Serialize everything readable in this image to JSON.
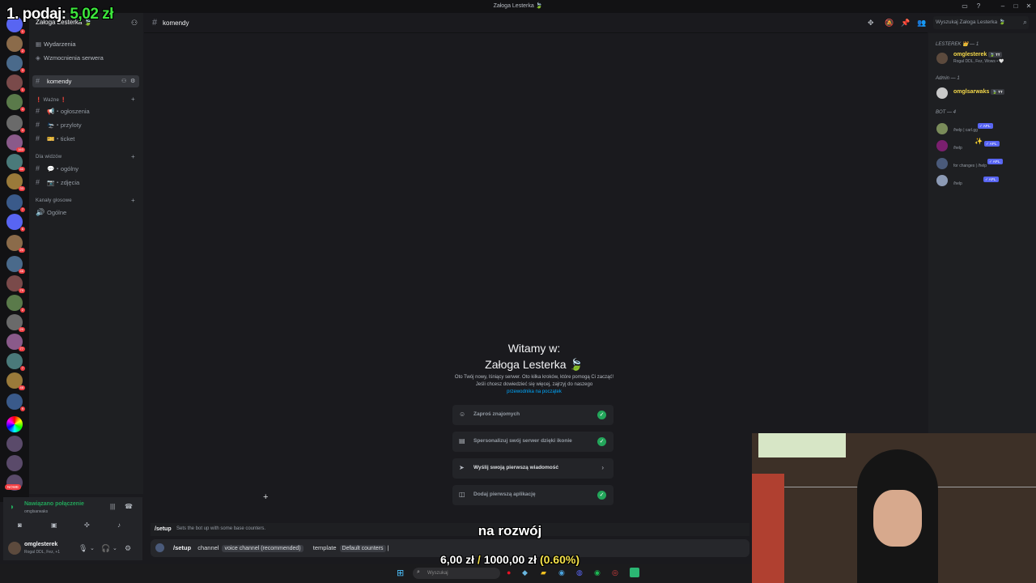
{
  "window": {
    "title": "Załoga Lesterka 🍃"
  },
  "server": {
    "name": "Załoga Lesterka 🍃",
    "nav": [
      {
        "label": "Wydarzenia",
        "icon": "calendar-icon"
      },
      {
        "label": "Wzmocnienia serwera",
        "icon": "boost-icon"
      }
    ],
    "active_channel": "komendy",
    "categories": [
      {
        "name": "❗ Ważne ❗",
        "channels": [
          "📢・ogłoszenia",
          "🛬・przyloty",
          "🎫・ticket"
        ]
      },
      {
        "name": "Dla widzów",
        "channels": [
          "💬・ogólny",
          "📷・zdjęcia"
        ]
      },
      {
        "name": "Kanały głosowe",
        "channels": [
          "Ogólne"
        ]
      }
    ],
    "new_badge": "NOWE"
  },
  "rail_badges": [
    "1",
    "2",
    "3",
    "1",
    "4",
    "4",
    "163",
    "40",
    "33",
    "7",
    "6",
    "20",
    "46",
    "79",
    "2",
    "20",
    "77",
    "7",
    "48",
    "9"
  ],
  "voice": {
    "status": "Nawiązano połączenie",
    "sub": "omglsarwaks"
  },
  "user": {
    "name": "omglesterek",
    "status": "Rogal DDL, Fez, +1"
  },
  "header": {
    "channel": "komendy",
    "search_placeholder": "Wyszukaj Załoga Lesterka 🍃"
  },
  "members": {
    "groups": [
      {
        "title": "LESTEREK 👑 — 1",
        "items": [
          {
            "name": "omglesterek",
            "tag": "🍃 TT",
            "sub": "Rogal DDL, Fez, Wows • 🤍",
            "color": "#f5d94a",
            "bot": false
          }
        ]
      },
      {
        "title": "Admin — 1",
        "items": [
          {
            "name": "omglsarwaks",
            "tag": "🍃 TT",
            "sub": "",
            "color": "#f5d94a",
            "bot": false
          }
        ]
      },
      {
        "title": "BOT — 4",
        "items": [
          {
            "name": "",
            "tag": "✓ APL.",
            "sub": "/help | carl.gg",
            "color": "#dbdee1",
            "bot": true
          },
          {
            "name": "✨",
            "tag": "✓ APL.",
            "sub": "/help",
            "color": "#dbdee1",
            "bot": true
          },
          {
            "name": "",
            "tag": "✓ APL.",
            "sub": "for changes | /help",
            "color": "#dbdee1",
            "bot": true
          },
          {
            "name": "",
            "tag": "✓ APL.",
            "sub": "/help",
            "color": "#dbdee1",
            "bot": true
          }
        ]
      }
    ]
  },
  "welcome": {
    "title_line1": "Witamy w:",
    "title_line2": "Załoga Lesterka 🍃",
    "desc": "Oto Twój nowy, lśniący serwer. Oto kilka kroków, które pomogą Ci zacząć! Jeśli chcesz dowiedzieć się więcej, zajrzyj do naszego",
    "link": "przewodnika na początek",
    "tasks": [
      {
        "label": "Zaproś znajomych",
        "done": true,
        "icon": "invite-icon"
      },
      {
        "label": "Spersonalizuj swój serwer dzięki ikonie",
        "done": true,
        "icon": "personalize-icon"
      },
      {
        "label": "Wyślij swoją pierwszą wiadomość",
        "done": false,
        "icon": "send-icon"
      },
      {
        "label": "Dodaj pierwszą aplikację",
        "done": true,
        "icon": "app-icon"
      }
    ]
  },
  "command": {
    "hint_name": "/setup",
    "hint_desc": "Sets the bot up with some base counters.",
    "input_cmd": "/setup",
    "opt1_name": "channel",
    "opt1_value": "voice channel (recommended)",
    "opt2_name": "template",
    "opt2_value": "Default counters"
  },
  "taskbar": {
    "search_placeholder": "Wyszukaj"
  },
  "overlay": {
    "donate_label": "1. podaj:",
    "donate_amount": "5,02 zł",
    "goal_label": "na rozwój",
    "goal_current": "6,00 zł",
    "goal_sep": "/",
    "goal_target": "1000,00 zł",
    "goal_percent": "(0.60%)"
  },
  "colors": {
    "accent": "#5865f2",
    "online": "#23a55a",
    "link": "#00a8fc",
    "donate_amount": "#3ce63c",
    "goal_percent": "#f4e14a"
  }
}
